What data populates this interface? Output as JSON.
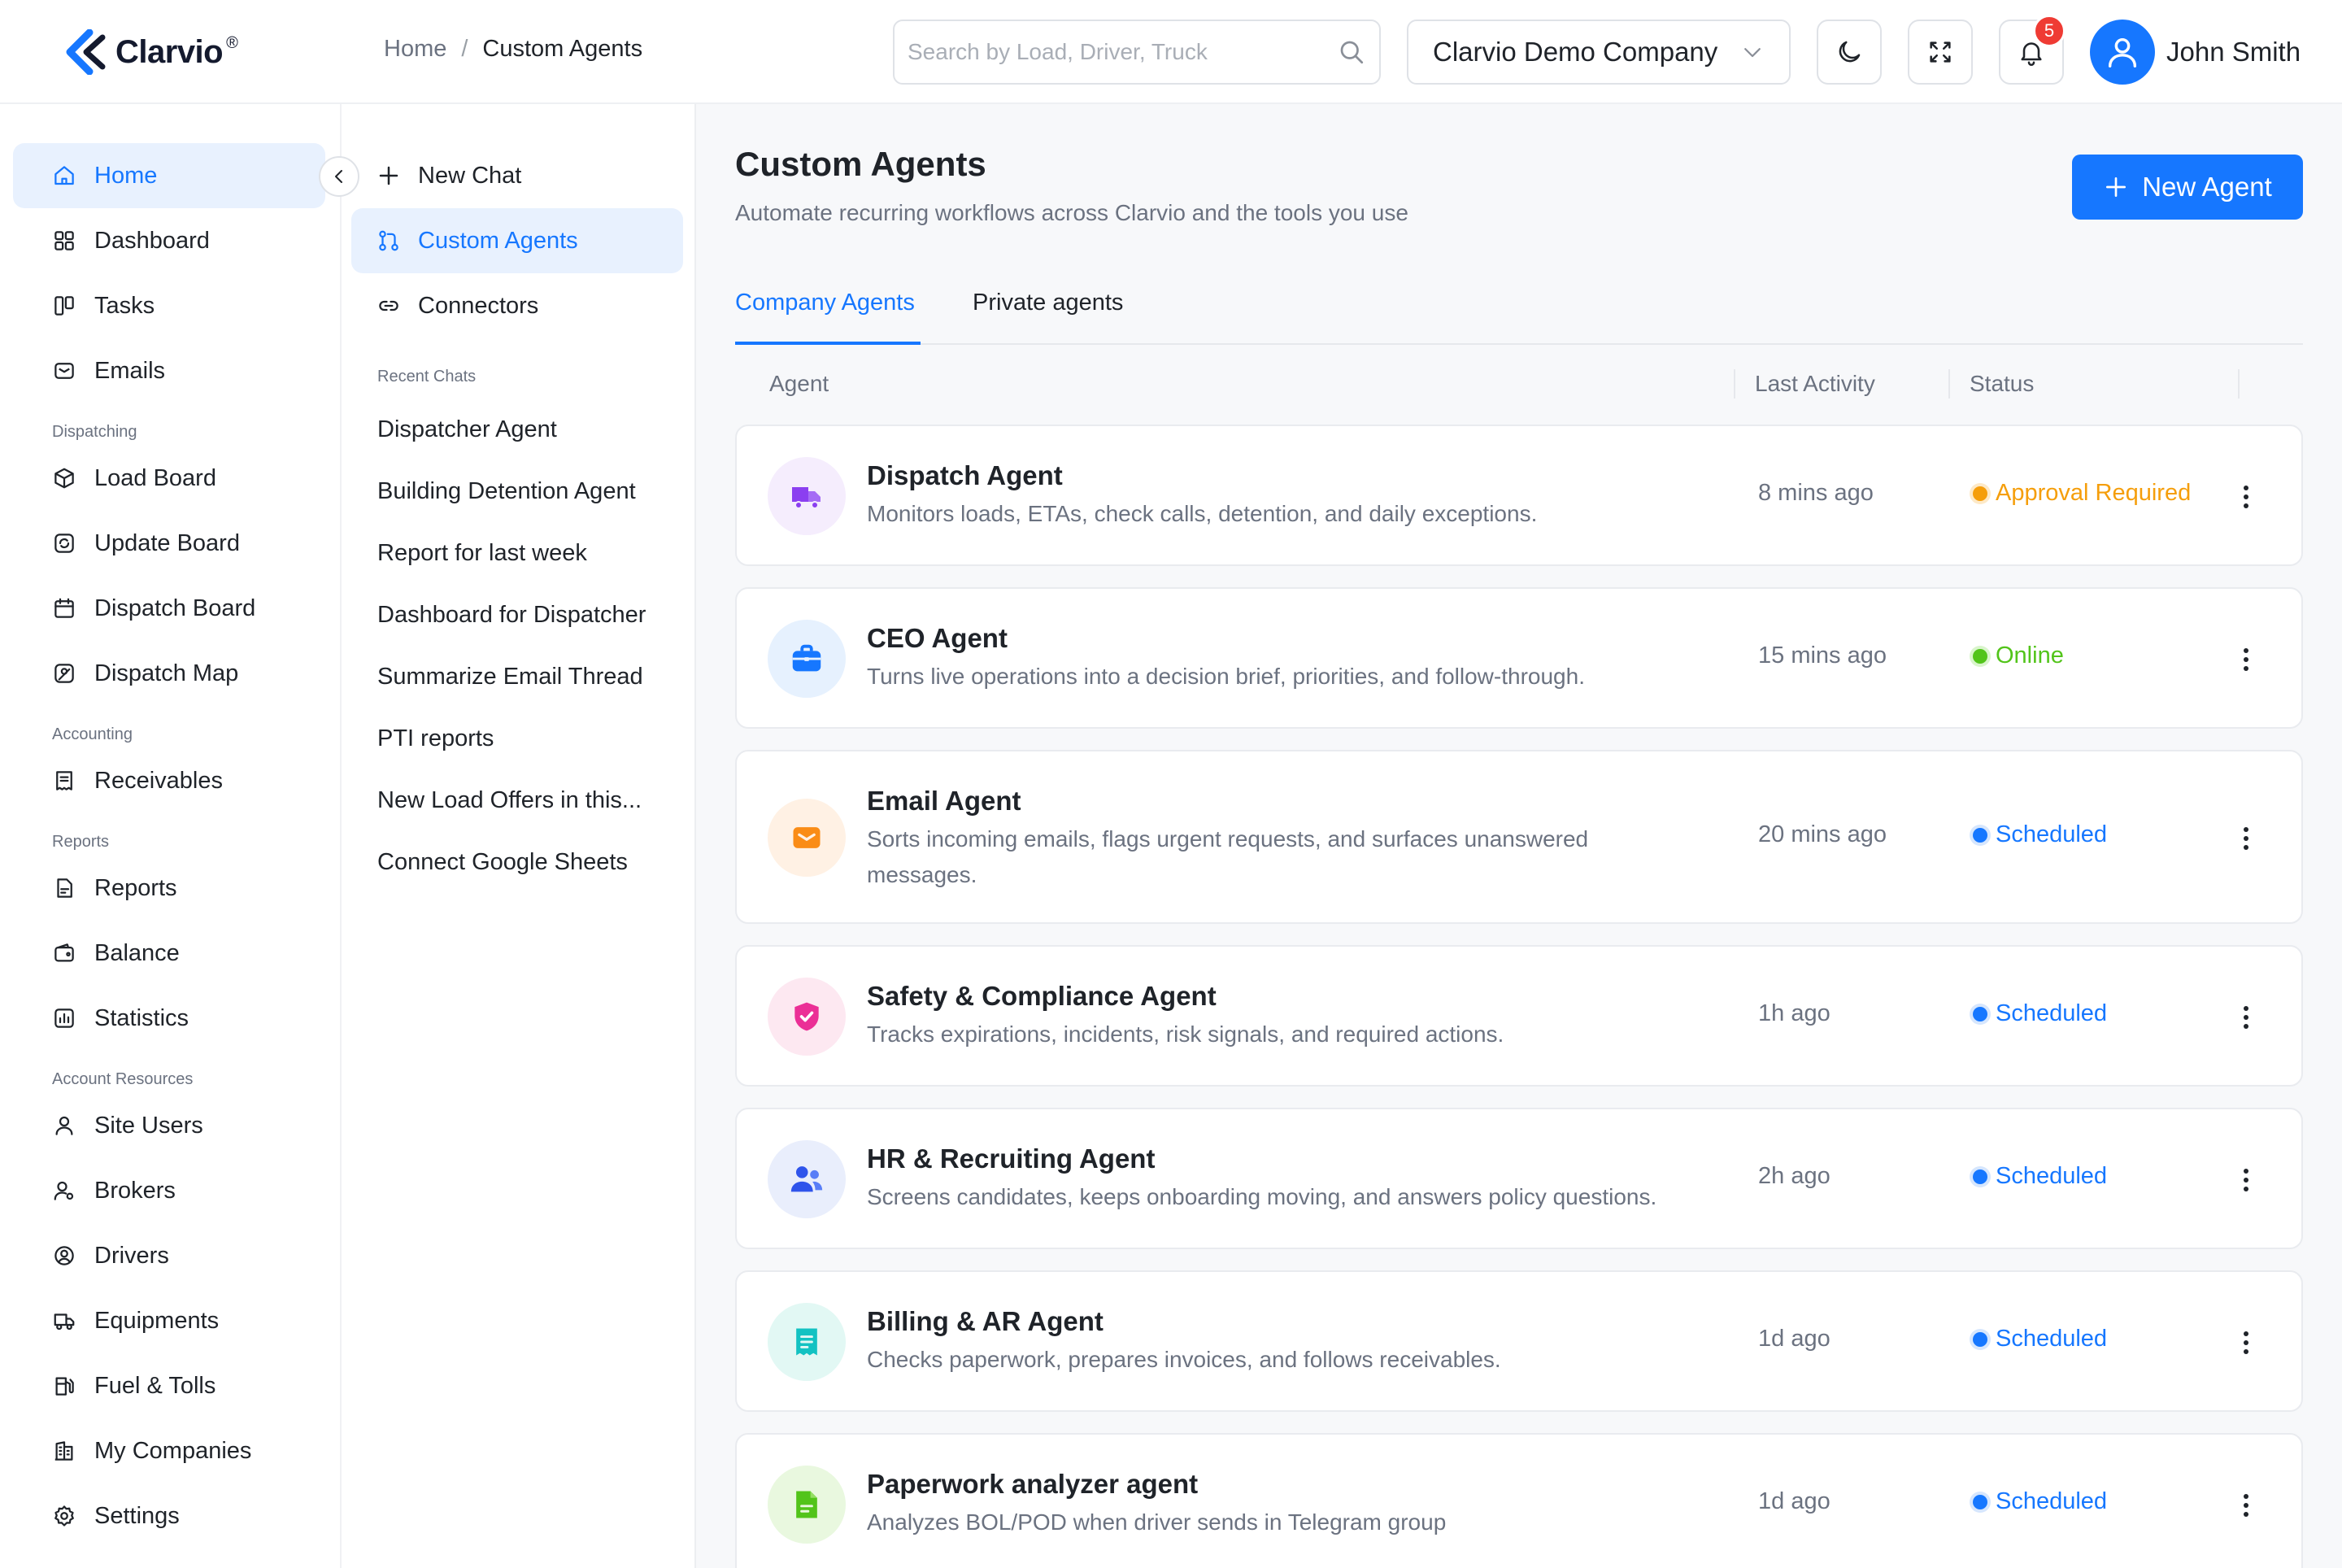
{
  "brand": {
    "name": "Clarvio",
    "mark": "®"
  },
  "breadcrumb": {
    "home": "Home",
    "separator": "/",
    "current": "Custom Agents"
  },
  "search": {
    "placeholder": "Search by Load, Driver, Truck"
  },
  "company_selector": {
    "value": "Clarvio Demo Company"
  },
  "notifications": {
    "count": "5"
  },
  "user": {
    "name": "John Smith"
  },
  "colors": {
    "accent": "#1677ff",
    "warning": "#f59e0b",
    "success": "#52c41a",
    "scheduled": "#1677ff"
  },
  "sidebar": {
    "items": [
      {
        "label": "Home",
        "icon": "home-icon"
      },
      {
        "label": "Dashboard",
        "icon": "grid-icon"
      },
      {
        "label": "Tasks",
        "icon": "kanban-icon"
      },
      {
        "label": "Emails",
        "icon": "mail-icon"
      },
      {
        "label": "Load Board",
        "icon": "box-icon"
      },
      {
        "label": "Update Board",
        "icon": "refresh-icon"
      },
      {
        "label": "Dispatch Board",
        "icon": "calendar-icon"
      },
      {
        "label": "Dispatch Map",
        "icon": "map-icon"
      },
      {
        "label": "Receivables",
        "icon": "receipt-icon"
      },
      {
        "label": "Reports",
        "icon": "report-icon"
      },
      {
        "label": "Balance",
        "icon": "wallet-icon"
      },
      {
        "label": "Statistics",
        "icon": "chart-icon"
      },
      {
        "label": "Site Users",
        "icon": "user-icon"
      },
      {
        "label": "Brokers",
        "icon": "broker-icon"
      },
      {
        "label": "Drivers",
        "icon": "driver-icon"
      },
      {
        "label": "Equipments",
        "icon": "truck-icon"
      },
      {
        "label": "Fuel & Tolls",
        "icon": "fuel-icon"
      },
      {
        "label": "My Companies",
        "icon": "building-icon"
      },
      {
        "label": "Settings",
        "icon": "gear-icon"
      }
    ],
    "sections": [
      "Dispatching",
      "Accounting",
      "Reports",
      "Account Resources"
    ]
  },
  "chat_panel": {
    "new_chat": "New Chat",
    "custom_agents": "Custom Agents",
    "connectors": "Connectors",
    "recent_title": "Recent Chats",
    "recent": [
      "Dispatcher Agent",
      "Building Detention Agent",
      "Report for last week",
      "Dashboard for Dispatcher",
      "Summarize Email Thread",
      "PTI reports",
      "New Load Offers in this...",
      "Connect Google Sheets"
    ]
  },
  "main": {
    "title": "Custom Agents",
    "subtitle": "Automate recurring workflows across Clarvio and the tools you use",
    "new_agent_label": "New Agent",
    "tabs": [
      "Company Agents",
      "Private agents"
    ],
    "columns": [
      "Agent",
      "Last Activity",
      "Status"
    ],
    "agents": [
      {
        "name": "Dispatch Agent",
        "description": "Monitors loads, ETAs, check calls, detention, and daily exceptions.",
        "last_activity": "8 mins ago",
        "status": "Approval Required",
        "status_color": "#f59e0b",
        "icon": "truck-icon"
      },
      {
        "name": "CEO Agent",
        "description": "Turns live operations into a decision brief, priorities, and follow-through.",
        "last_activity": "15 mins ago",
        "status": "Online",
        "status_color": "#52c41a",
        "icon": "briefcase-icon"
      },
      {
        "name": "Email Agent",
        "description": "Sorts incoming emails, flags urgent requests, and surfaces unanswered messages.",
        "last_activity": "20 mins ago",
        "status": "Scheduled",
        "status_color": "#1677ff",
        "icon": "mail-icon"
      },
      {
        "name": "Safety & Compliance Agent",
        "description": "Tracks expirations, incidents, risk signals, and required actions.",
        "last_activity": "1h ago",
        "status": "Scheduled",
        "status_color": "#1677ff",
        "icon": "shield-check-icon"
      },
      {
        "name": "HR & Recruiting Agent",
        "description": "Screens candidates, keeps onboarding moving, and answers policy questions.",
        "last_activity": "2h ago",
        "status": "Scheduled",
        "status_color": "#1677ff",
        "icon": "users-icon"
      },
      {
        "name": "Billing & AR Agent",
        "description": "Checks paperwork, prepares invoices, and follows receivables.",
        "last_activity": "1d ago",
        "status": "Scheduled",
        "status_color": "#1677ff",
        "icon": "receipt-icon"
      },
      {
        "name": "Paperwork analyzer agent",
        "description": "Analyzes BOL/POD when driver sends in Telegram group",
        "last_activity": "1d ago",
        "status": "Scheduled",
        "status_color": "#1677ff",
        "icon": "document-icon"
      }
    ]
  }
}
